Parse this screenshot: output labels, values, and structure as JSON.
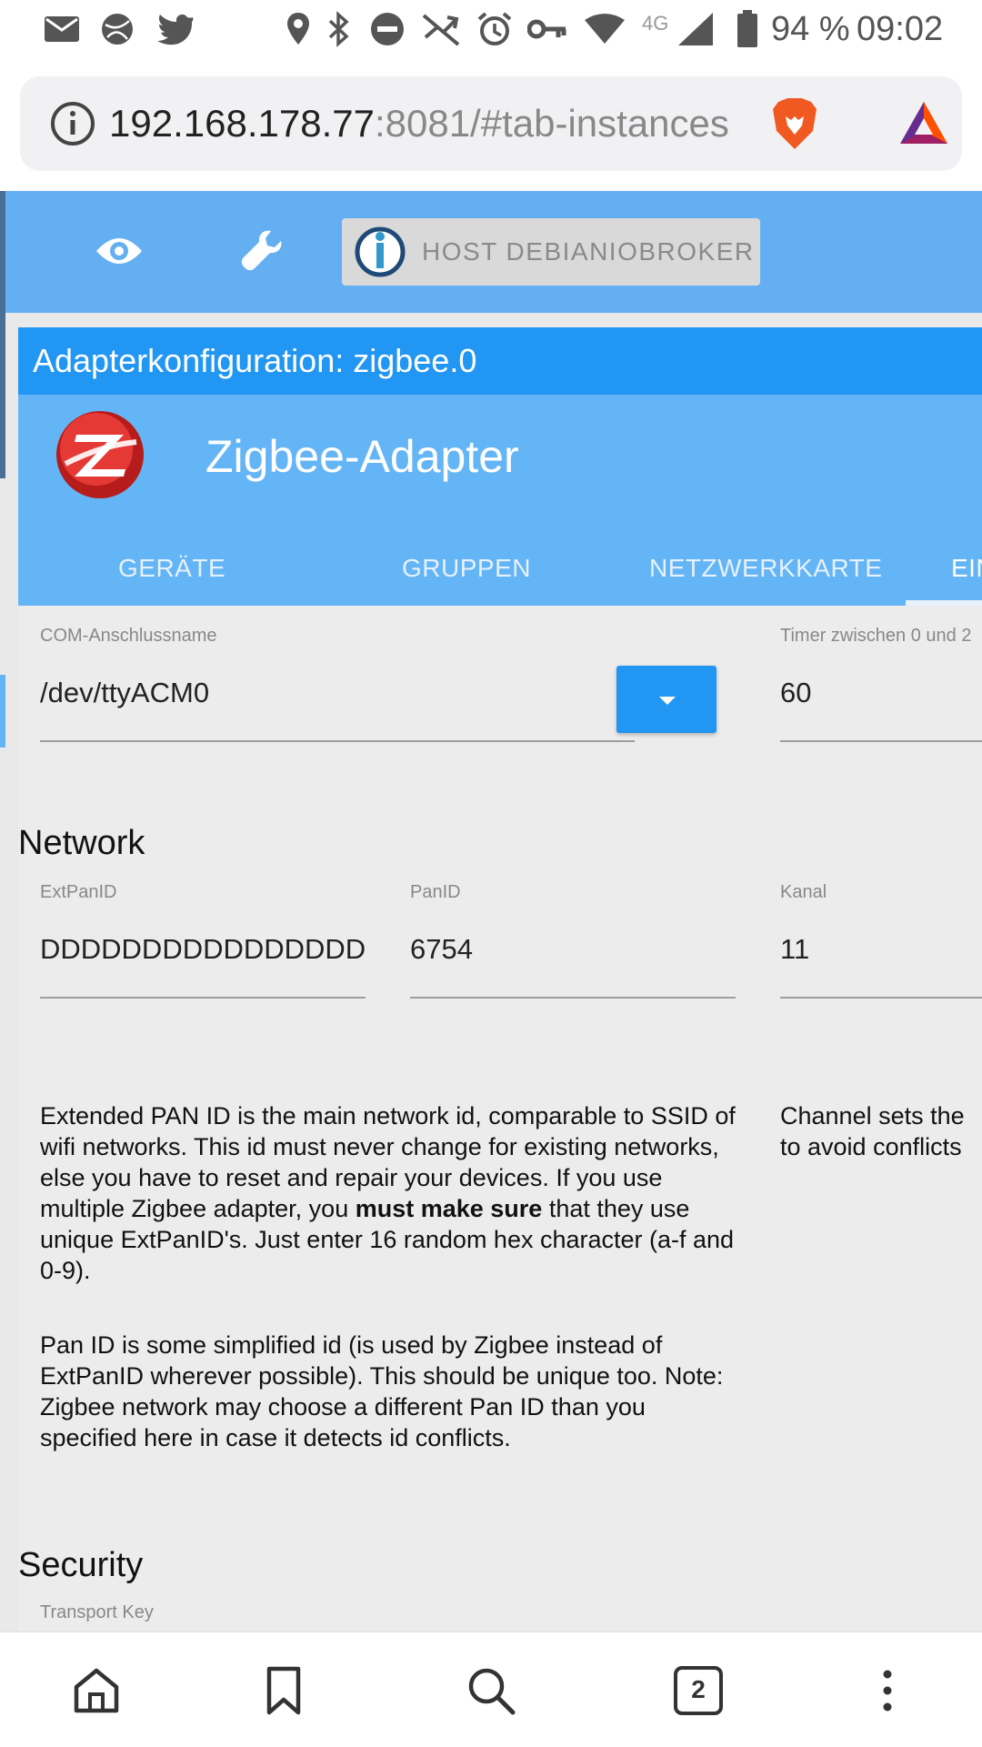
{
  "status_bar": {
    "battery_percent": "94 %",
    "time": "09:02",
    "network_type": "4G"
  },
  "browser": {
    "url_host": "192.168.178.77",
    "url_rest": ":8081/#tab-instances",
    "tab_count": "2"
  },
  "app_header": {
    "host_button_label": "HOST DEBIANIOBROKER"
  },
  "dialog": {
    "title": "Adapterkonfiguration: zigbee.0",
    "adapter_name": "Zigbee-Adapter",
    "tabs": [
      {
        "label": "GERÄTE"
      },
      {
        "label": "GRUPPEN"
      },
      {
        "label": "NETZWERKKARTE"
      },
      {
        "label": "EIN"
      }
    ],
    "com_port": {
      "label": "COM-Anschlussname",
      "value": "/dev/ttyACM0"
    },
    "timer": {
      "label": "Timer zwischen 0 und 2",
      "value": "60"
    },
    "network": {
      "heading": "Network",
      "extpanid": {
        "label": "ExtPanID",
        "value": "DDDDDDDDDDDDDDDD"
      },
      "panid": {
        "label": "PanID",
        "value": "6754"
      },
      "channel": {
        "label": "Kanal",
        "value": "11"
      },
      "help_ext_1": "Extended PAN ID is the main network id, comparable to SSID of wifi networks. This id must never change for existing networks, else you have to reset and repair your devices. If you use multiple Zigbee adapter, you ",
      "help_ext_bold": "must make sure",
      "help_ext_2": " that they use unique ExtPanID's. Just enter 16 random hex character (a-f and 0-9).",
      "help_pan": "Pan ID is some simplified id (is used by Zigbee instead of ExtPanID wherever possible). This should be unique too. Note: Zigbee network may choose a different Pan ID than you specified here in case it detects id conflicts.",
      "help_channel": "Channel sets the to avoid conflicts"
    },
    "security": {
      "heading": "Security",
      "transport_key_label": "Transport Key"
    }
  },
  "colors": {
    "app_bar": "#64aff1",
    "dialog_title": "#2196f3",
    "dialog_header": "#64b5f6",
    "page_background": "#e9e9ea"
  }
}
